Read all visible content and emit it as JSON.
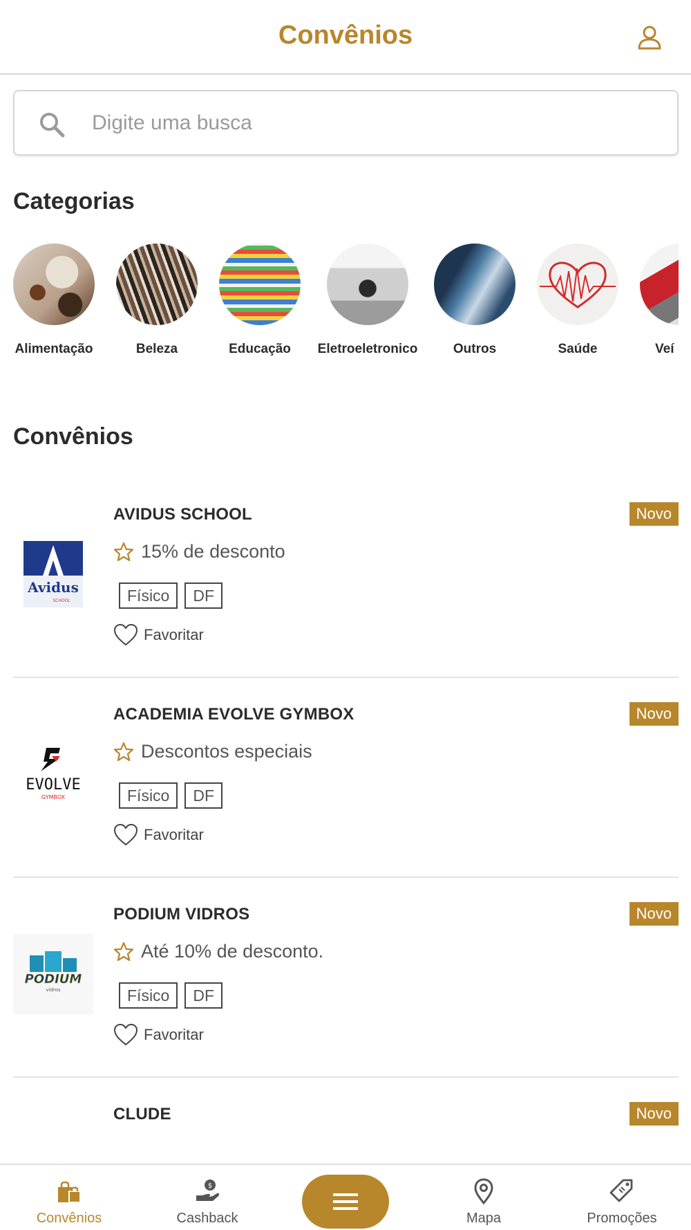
{
  "header": {
    "title": "Convênios",
    "profile_icon": "user-icon"
  },
  "search": {
    "placeholder": "Digite uma busca",
    "value": ""
  },
  "categories_title": "Categorias",
  "categories": [
    {
      "label": "Alimentação"
    },
    {
      "label": "Beleza"
    },
    {
      "label": "Educação"
    },
    {
      "label": "Eletroeletronico"
    },
    {
      "label": "Outros"
    },
    {
      "label": "Saúde"
    },
    {
      "label": "Veí"
    }
  ],
  "convenios_title": "Convênios",
  "convenios": [
    {
      "name": "AVIDUS SCHOOL",
      "badge": "Novo",
      "discount": "15% de desconto",
      "tags": [
        "Físico",
        "DF"
      ],
      "fav_label": "Favoritar",
      "logo_text": "Avidus",
      "logo_sub": "SCHOOL",
      "logo_mark": "A"
    },
    {
      "name": "ACADEMIA EVOLVE GYMBOX",
      "badge": "Novo",
      "discount": "Descontos especiais",
      "tags": [
        "Físico",
        "DF"
      ],
      "fav_label": "Favoritar",
      "logo_text": "EVOLVE",
      "logo_sub": "GYMBOX",
      "logo_mark": "E"
    },
    {
      "name": "PODIUM VIDROS",
      "badge": "Novo",
      "discount": "Até 10% de desconto.",
      "tags": [
        "Físico",
        "DF"
      ],
      "fav_label": "Favoritar",
      "logo_text": "PODIUM",
      "logo_sub": "vidros",
      "logo_mark": "P"
    },
    {
      "name": "CLUDE",
      "badge": "Novo",
      "discount": "",
      "tags": [],
      "fav_label": ""
    }
  ],
  "bottom_nav": [
    {
      "label": "Convênios",
      "icon": "shopping-bag-icon",
      "active": true
    },
    {
      "label": "Cashback",
      "icon": "cashback-hand-icon",
      "active": false
    },
    {
      "label": "",
      "icon": "menu-icon",
      "active": false
    },
    {
      "label": "Mapa",
      "icon": "map-pin-icon",
      "active": false
    },
    {
      "label": "Promoções",
      "icon": "tag-icon",
      "active": false
    }
  ],
  "colors": {
    "accent": "#b8862b",
    "text": "#2b2b2b",
    "divider": "#e2e2e2"
  }
}
